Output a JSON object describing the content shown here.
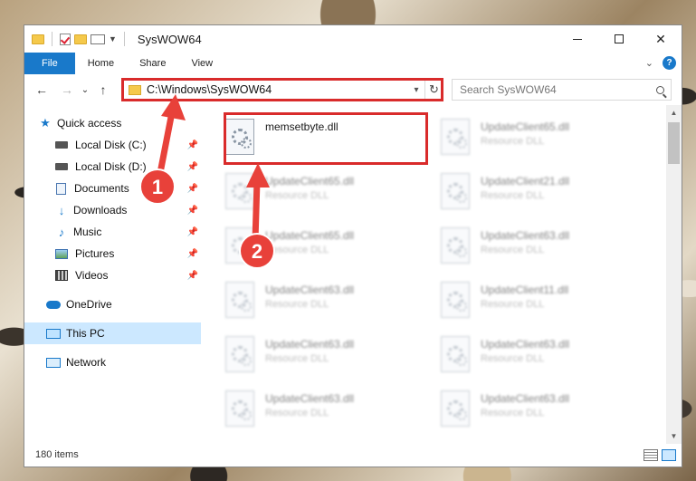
{
  "window": {
    "title": "SysWOW64",
    "controls": {
      "minimize": "—",
      "maximize": "☐",
      "close": "✕"
    }
  },
  "ribbon": {
    "tabs": [
      "File",
      "Home",
      "Share",
      "View"
    ],
    "help": "?"
  },
  "nav": {
    "back": "←",
    "forward": "→",
    "recent": "⌄",
    "up": "↑",
    "address": "C:\\Windows\\SysWOW64",
    "search_placeholder": "Search SysWOW64"
  },
  "sidebar": {
    "quick_access": "Quick access",
    "items": [
      {
        "label": "Local Disk (C:)",
        "icon": "disk-icon"
      },
      {
        "label": "Local Disk (D:)",
        "icon": "disk-icon"
      },
      {
        "label": "Documents",
        "icon": "documents-icon"
      },
      {
        "label": "Downloads",
        "icon": "downloads-icon"
      },
      {
        "label": "Music",
        "icon": "music-icon"
      },
      {
        "label": "Pictures",
        "icon": "pictures-icon"
      },
      {
        "label": "Videos",
        "icon": "videos-icon"
      }
    ],
    "onedrive": "OneDrive",
    "this_pc": "This PC",
    "network": "Network"
  },
  "files": [
    {
      "name": "memsetbyte.dll",
      "type": ""
    },
    {
      "name": "UpdateClient65.dll",
      "type": "Resource DLL"
    },
    {
      "name": "UpdateClient65.dll",
      "type": "Resource DLL"
    },
    {
      "name": "UpdateClient21.dll",
      "type": "Resource DLL"
    },
    {
      "name": "UpdateClient65.dll",
      "type": "Resource DLL"
    },
    {
      "name": "UpdateClient63.dll",
      "type": "Resource DLL"
    },
    {
      "name": "UpdateClient63.dll",
      "type": "Resource DLL"
    },
    {
      "name": "UpdateClient11.dll",
      "type": "Resource DLL"
    },
    {
      "name": "UpdateClient63.dll",
      "type": "Resource DLL"
    },
    {
      "name": "UpdateClient63.dll",
      "type": "Resource DLL"
    },
    {
      "name": "UpdateClient63.dll",
      "type": "Resource DLL"
    },
    {
      "name": "UpdateClient63.dll",
      "type": "Resource DLL"
    }
  ],
  "status": {
    "count": "180 items"
  },
  "annotations": {
    "step1": "1",
    "step2": "2",
    "color": "#e8413a"
  }
}
